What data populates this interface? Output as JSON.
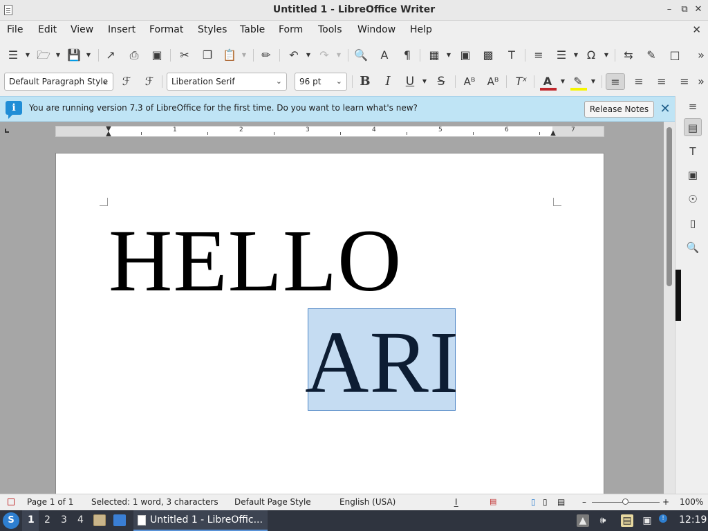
{
  "window": {
    "title": "Untitled 1 - LibreOffice Writer"
  },
  "menubar": {
    "items": [
      "File",
      "Edit",
      "View",
      "Insert",
      "Format",
      "Styles",
      "Table",
      "Form",
      "Tools",
      "Window",
      "Help"
    ]
  },
  "formatting": {
    "paragraph_style": "Default Paragraph Style",
    "font_name": "Liberation Serif",
    "font_size": "96 pt"
  },
  "infobar": {
    "message": "You are running version 7.3 of LibreOffice for the first time. Do you want to learn what's new?",
    "button_label": "Release Notes"
  },
  "ruler": {
    "labels": [
      "1",
      "2",
      "3",
      "4",
      "5",
      "6",
      "7"
    ]
  },
  "document": {
    "line1": "HELLO",
    "line2": "ARI",
    "selected_text": "ARI"
  },
  "statusbar": {
    "page": "Page 1 of 1",
    "selection": "Selected: 1 word, 3 characters",
    "page_style": "Default Page Style",
    "language": "English (USA)",
    "zoom": "100%"
  },
  "taskbar": {
    "workspaces": [
      "1",
      "2",
      "3",
      "4"
    ],
    "active_workspace": "1",
    "task_label": "Untitled 1 - LibreOffic...",
    "clock": "12:19"
  },
  "colors": {
    "selection": "#c5dcf2",
    "infobar": "#bfe4f5",
    "font_color_swatch": "#c0282d",
    "highlight_swatch": "#f5f500",
    "taskbar": "#2f343f"
  }
}
